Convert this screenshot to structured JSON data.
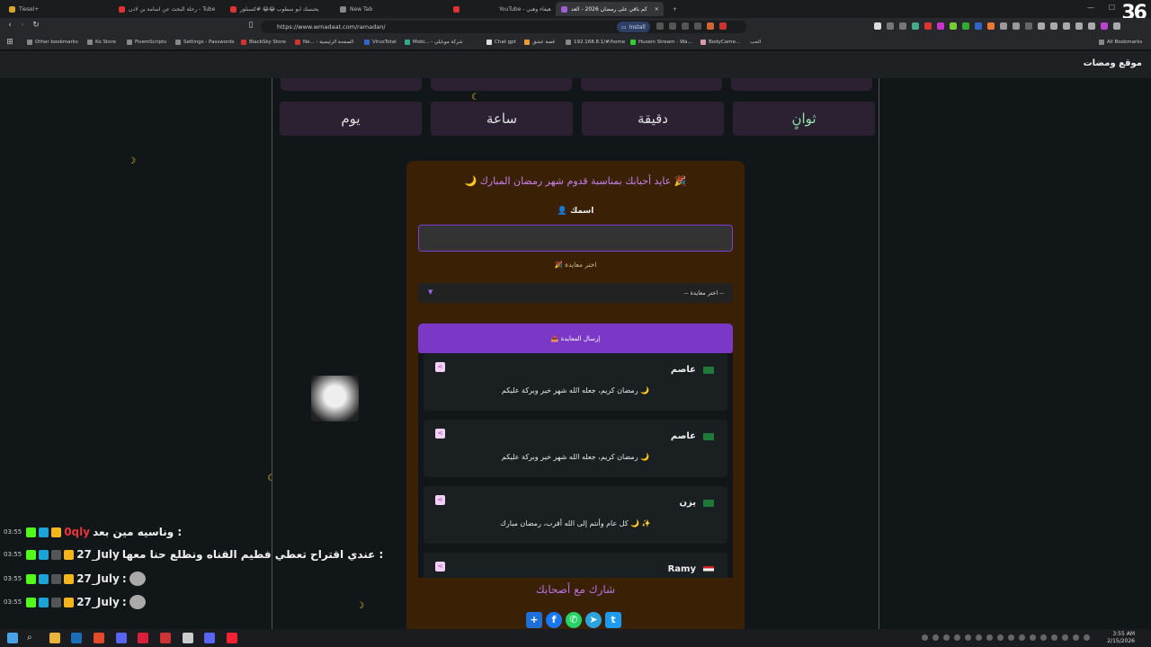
{
  "browser": {
    "tabs": [
      {
        "label": "Tiesel+"
      },
      {
        "label": "رحلة البحث عن اسامة بن لادن - Tube"
      },
      {
        "label": "يحبسك ابو سطوب 😂😂 #كسبلور"
      },
      {
        "label": "New Tab"
      },
      {
        "label": "YouTube - هيفاء وهبي"
      },
      {
        "label": "كم باقي على رمضان 2026 - العد"
      }
    ],
    "url": "https://www.wmadaat.com/ramadan/",
    "install_label": "Install",
    "bookmarks": [
      "Other bookmarks",
      "Ko Store",
      "FivemScripts",
      "Settings - Passwords",
      "BlackSky Store",
      "Ne... - الصفحة الرئيسية",
      "VirusTotal",
      "Mobi... - شركة موبايلي",
      "Chat gpt",
      "قصة عشق",
      "192.168.8.1/#/home",
      "Husein Stream - Wa...",
      "BodyCame...",
      "الحب"
    ],
    "all_bookmarks": "All Bookmarks"
  },
  "site": {
    "title": "موقع ومضات"
  },
  "countdown": {
    "units": [
      {
        "label": "يوم"
      },
      {
        "label": "ساعة"
      },
      {
        "label": "دقيقة"
      },
      {
        "label": "ثوانٍ"
      }
    ]
  },
  "card": {
    "title": "🌙 عايد أحبابك بمناسبة قدوم شهر رمضان المبارك 🎉",
    "name_label": "👤 اسمك",
    "name_placeholder": "",
    "greeting_label": "🎉 اختر معايدة",
    "select_value": "-- اختر معايدة --",
    "send_label": "📤 إرسال المعايدة",
    "messages": [
      {
        "author": "عاصم",
        "text": "رمضان كريم، جعله الله شهر خير وبركة عليكم 🌙"
      },
      {
        "author": "عاصم",
        "text": "رمضان كريم، جعله الله شهر خير وبركة عليكم 🌙"
      },
      {
        "author": "يزن",
        "text": "كل عام وأنتم إلى الله أقرب، رمضان مبارك 🌙 ✨"
      },
      {
        "author": "Ramy",
        "text": ""
      }
    ],
    "share_title": "شارك مع أصحابك",
    "social_icons": [
      "plus-icon",
      "facebook-icon",
      "whatsapp-icon",
      "telegram-icon",
      "twitter-icon"
    ]
  },
  "chat": [
    {
      "time": "03:55",
      "user": "0qly",
      "message": "وناسيه مين بعد :"
    },
    {
      "time": "03:55",
      "user": "27_July",
      "message": "عندي اقتراح تعطي فطيم القناه ونطلع حنا معها :"
    },
    {
      "time": "03:55",
      "user": "27_July",
      "message": ":"
    },
    {
      "time": "03:55",
      "user": "27_July",
      "message": ":"
    }
  ],
  "taskbar": {
    "time": "3:55 AM",
    "date": "2/15/2026"
  },
  "colors": {
    "accent": "#7b38c7",
    "card_bg": "#3a2106",
    "page_bg": "#111619"
  }
}
